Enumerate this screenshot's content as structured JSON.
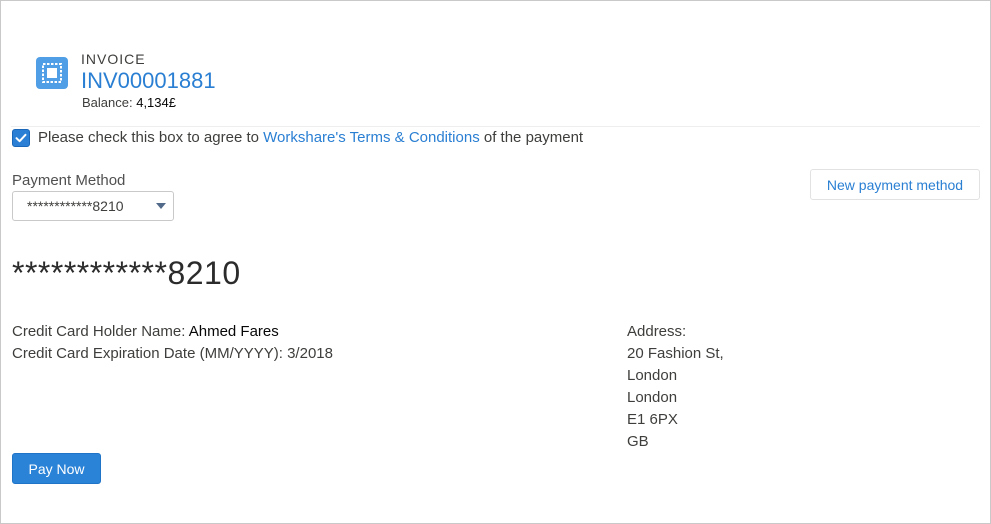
{
  "invoice": {
    "label": "INVOICE",
    "number": "INV00001881",
    "balance_label": "Balance:",
    "balance_value": "4,134£",
    "icon": "invoice-icon"
  },
  "terms": {
    "checked": true,
    "text_before": "Please check this box to agree to ",
    "link_text": "Workshare's Terms & Conditions",
    "text_after": " of the payment"
  },
  "payment_method": {
    "label": "Payment Method",
    "selected": "************8210",
    "new_button_label": "New payment method"
  },
  "card": {
    "masked_number": "************8210",
    "holder_label": "Credit Card Holder Name: ",
    "holder_value": "Ahmed Fares",
    "expiration_label": "Credit Card Expiration Date (MM/YYYY): ",
    "expiration_value": "3/2018"
  },
  "address": {
    "label": "Address:",
    "lines": [
      "20 Fashion St,",
      "London",
      "London",
      "E1 6PX",
      "GB"
    ]
  },
  "actions": {
    "pay_now_label": "Pay Now"
  },
  "colors": {
    "accent": "#2a7fd3",
    "primary_button": "#2b83d7",
    "icon_bg": "#4f9ee6"
  }
}
